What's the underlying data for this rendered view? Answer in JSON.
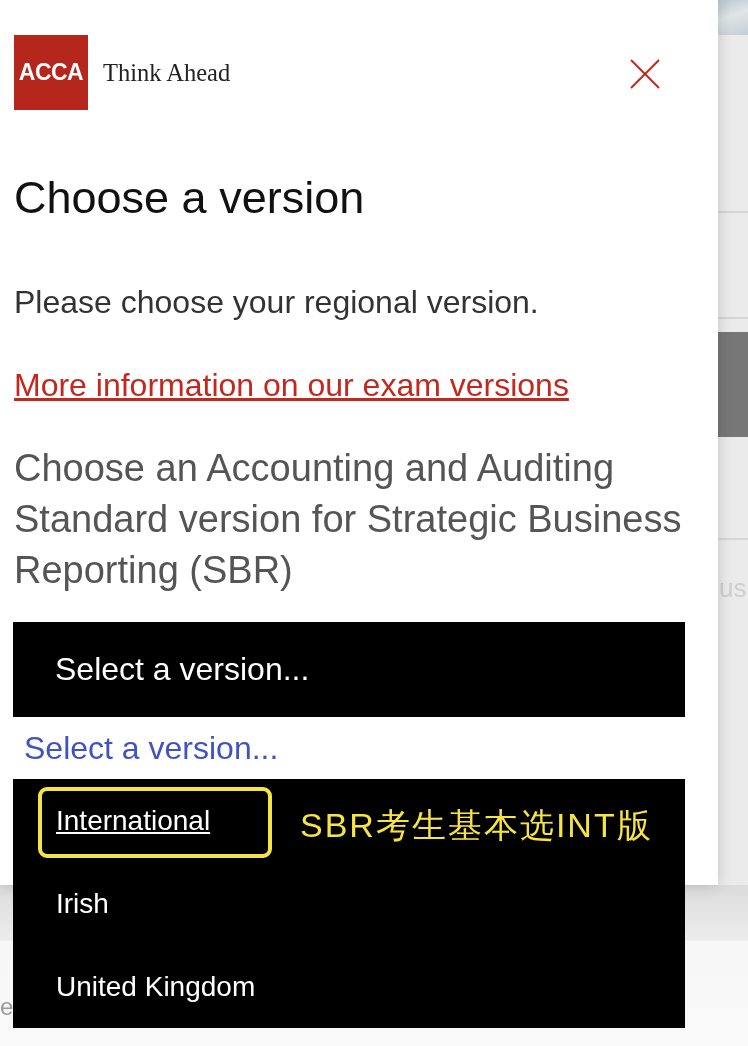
{
  "header": {
    "logo": "ACCA",
    "tagline": "Think Ahead"
  },
  "title": "Choose a version",
  "intro": "Please choose your regional version.",
  "link": "More information on our exam versions",
  "question": "Choose an Accounting and Auditing Standard version for Strategic Business Reporting (SBR)",
  "select": {
    "value": "Select a version...",
    "expanded": true
  },
  "dropdown": {
    "prompt": "Select a version...",
    "options": [
      {
        "label": "International",
        "focused": true,
        "circled": true,
        "note": "SBR考生基本选INT版"
      },
      {
        "label": "Irish",
        "focused": false,
        "circled": false
      },
      {
        "label": "United Kingdom",
        "focused": false,
        "circled": false
      }
    ]
  },
  "background_page": {
    "side_text": "us",
    "bottom_text": "e"
  }
}
